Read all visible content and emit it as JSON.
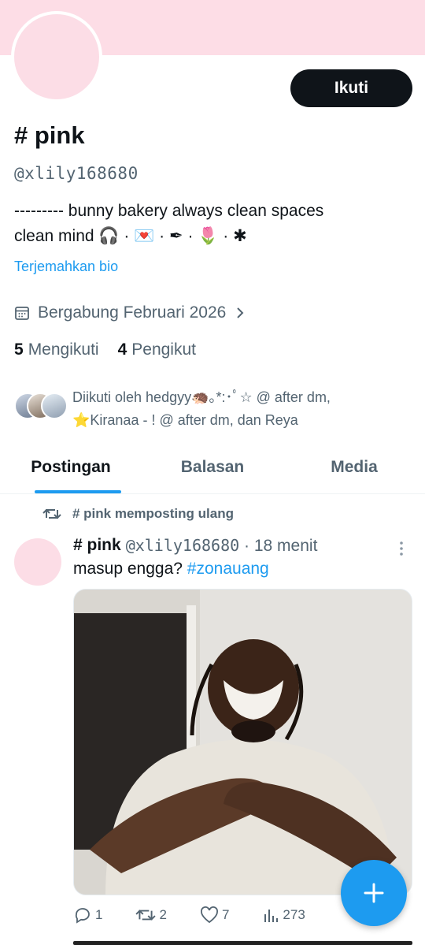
{
  "profile": {
    "display_name": "# pink",
    "handle": "@xlily168680",
    "bio_line1": "--------- bunny bakery always clean spaces",
    "bio_line2": "clean mind 🎧 · 💌 · ✒ · 🌷 · ✱",
    "translate_link": "Terjemahkan bio",
    "joined": "Bergabung Februari 2026",
    "following_count": "5",
    "following_label": "Mengikuti",
    "followers_count": "4",
    "followers_label": "Pengikut",
    "followed_by_line1": "Diikuti oleh hedgyy🦔｡*:･ﾟ☆ @ after dm,",
    "followed_by_line2": "⭐Kiranaa - ! @ after dm, dan Reya"
  },
  "follow_button": "Ikuti",
  "tabs": [
    {
      "label": "Postingan",
      "active": true
    },
    {
      "label": "Balasan",
      "active": false
    },
    {
      "label": "Media",
      "active": false
    }
  ],
  "post": {
    "repost_label": "# pink memposting ulang",
    "author_name": "# pink",
    "author_handle": "@xlily168680",
    "time": "18 menit",
    "text": "masup engga?",
    "hashtag": "#zonauang",
    "replies": "1",
    "reposts": "2",
    "likes": "7",
    "views": "273"
  },
  "colors": {
    "banner": "#fddde6",
    "avatar": "#fcdde6",
    "accent": "#1d9bf0",
    "follow_bg": "#0f1419"
  },
  "icons": [
    "calendar-icon",
    "chevron-right-icon",
    "repost-icon",
    "more-icon",
    "reply-icon",
    "like-icon",
    "views-icon",
    "plus-icon"
  ]
}
